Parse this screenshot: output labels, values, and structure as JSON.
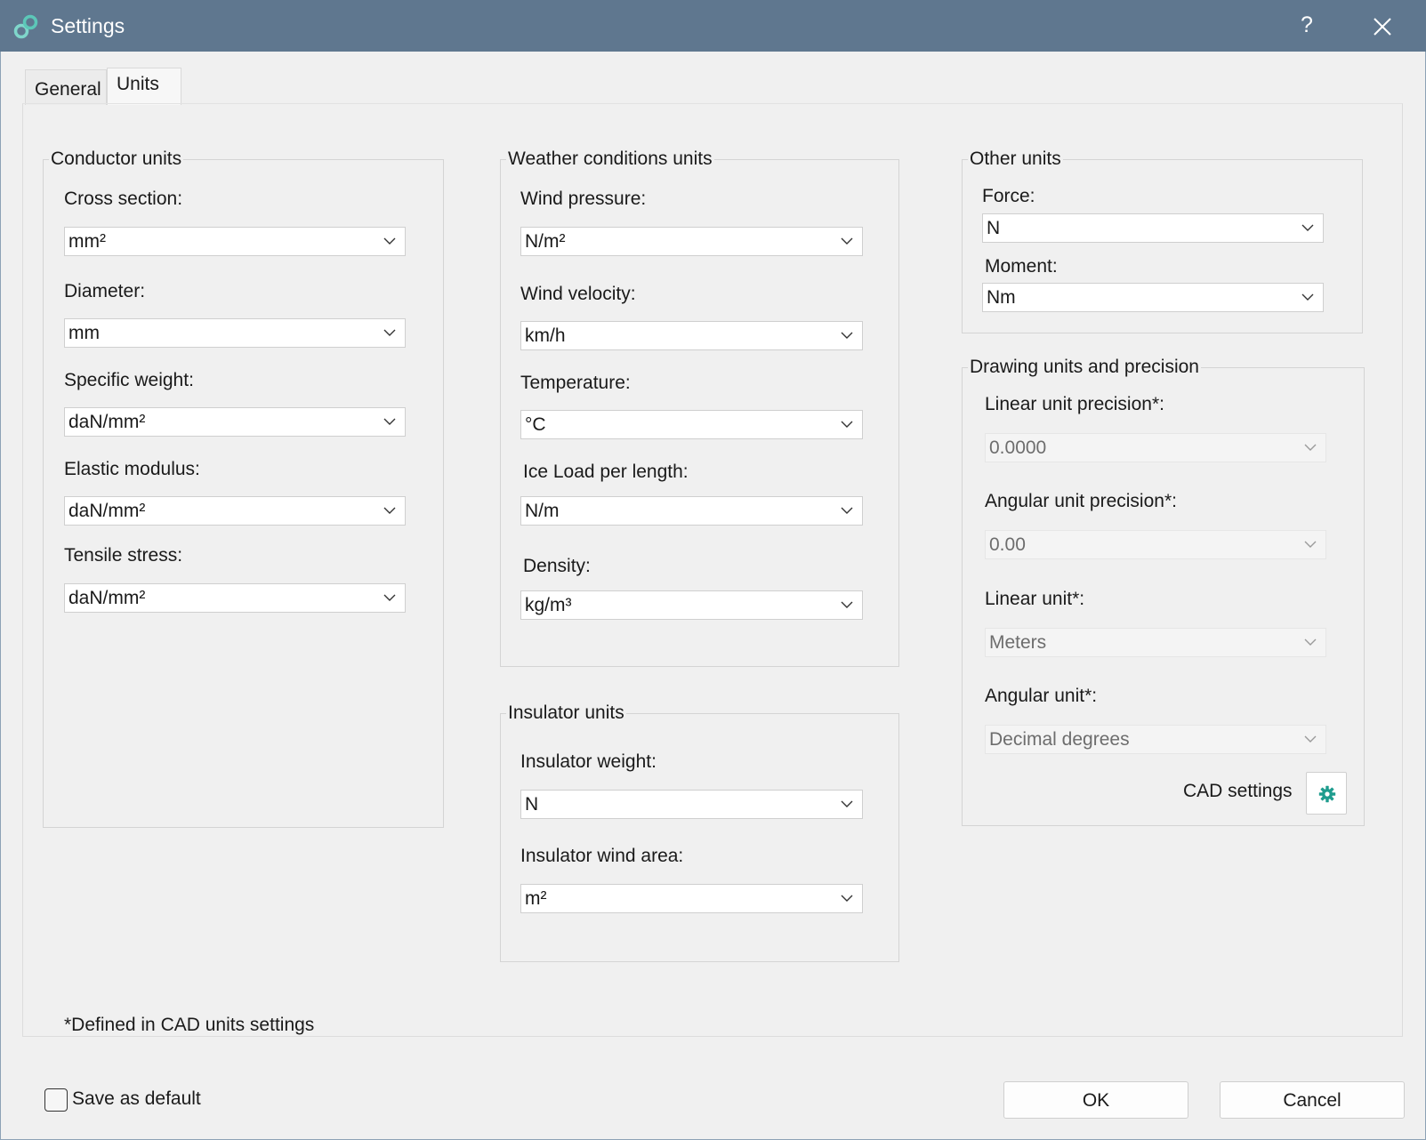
{
  "window": {
    "title": "Settings",
    "help_label": "?"
  },
  "tabs": [
    {
      "label": "General",
      "active": false
    },
    {
      "label": "Units",
      "active": true
    }
  ],
  "conductor_units": {
    "legend": "Conductor units",
    "fields": [
      {
        "label": "Cross section:",
        "value": "mm²"
      },
      {
        "label": "Diameter:",
        "value": "mm"
      },
      {
        "label": "Specific weight:",
        "value": "daN/mm²"
      },
      {
        "label": "Elastic modulus:",
        "value": "daN/mm²"
      },
      {
        "label": "Tensile stress:",
        "value": "daN/mm²"
      }
    ]
  },
  "weather_units": {
    "legend": "Weather conditions units",
    "fields": [
      {
        "label": "Wind pressure:",
        "value": "N/m²"
      },
      {
        "label": "Wind velocity:",
        "value": "km/h"
      },
      {
        "label": "Temperature:",
        "value": "°C"
      },
      {
        "label": "Ice Load per length:",
        "value": "N/m"
      },
      {
        "label": "Density:",
        "value": "kg/m³"
      }
    ]
  },
  "insulator_units": {
    "legend": "Insulator units",
    "fields": [
      {
        "label": "Insulator weight:",
        "value": "N"
      },
      {
        "label": "Insulator wind area:",
        "value": "m²"
      }
    ]
  },
  "other_units": {
    "legend": "Other units",
    "fields": [
      {
        "label": "Force:",
        "value": "N"
      },
      {
        "label": "Moment:",
        "value": "Nm"
      }
    ]
  },
  "drawing_units": {
    "legend": "Drawing units and precision",
    "fields": [
      {
        "label": "Linear unit precision*:",
        "value": "0.0000",
        "disabled": true
      },
      {
        "label": "Angular unit precision*:",
        "value": "0.00",
        "disabled": true
      },
      {
        "label": "Linear unit*:",
        "value": "Meters",
        "disabled": true
      },
      {
        "label": "Angular unit*:",
        "value": "Decimal degrees",
        "disabled": true
      }
    ],
    "cad_settings_label": "CAD settings"
  },
  "footnote": "*Defined in CAD units settings",
  "footer": {
    "save_default_label": "Save as default",
    "save_default_checked": false,
    "ok_label": "OK",
    "cancel_label": "Cancel"
  },
  "colors": {
    "titlebar": "#5f778f",
    "gear_accent": "#1e9c8e"
  }
}
